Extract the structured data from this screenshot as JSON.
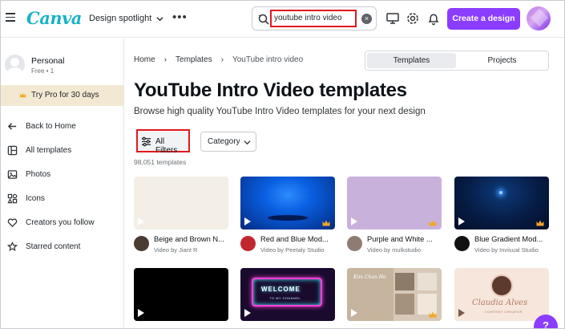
{
  "topbar": {
    "logo": "Canva",
    "spotlight_label": "Design spotlight",
    "more": "•••",
    "search_value": "youtube intro video",
    "create_label": "Create a design"
  },
  "sidebar": {
    "profile_name": "Personal",
    "profile_sub": "Free • 1",
    "try_pro": "Try Pro for 30 days",
    "nav": [
      {
        "label": "Back to Home",
        "icon": "arrow-left-icon"
      },
      {
        "label": "All templates",
        "icon": "templates-icon"
      },
      {
        "label": "Photos",
        "icon": "photo-icon"
      },
      {
        "label": "Icons",
        "icon": "shapes-icon"
      },
      {
        "label": "Creators you follow",
        "icon": "heart-icon"
      },
      {
        "label": "Starred content",
        "icon": "star-icon"
      }
    ]
  },
  "main": {
    "breadcrumb": [
      "Home",
      "Templates",
      "YouTube intro video"
    ],
    "tabs": [
      "Templates",
      "Projects"
    ],
    "title": "YouTube Intro Video templates",
    "subtitle": "Browse high quality YouTube Intro Video templates for your next design",
    "filters_label": "All Filters",
    "category_label": "Category",
    "count": "98,051 templates"
  },
  "cards": [
    {
      "title": "Beige and Brown N...",
      "by": "Video by Jiant R"
    },
    {
      "title": "Red and Blue Mod...",
      "by": "Video by Peetaly Studio"
    },
    {
      "title": "Purple and White ...",
      "by": "Video by mulkstudio"
    },
    {
      "title": "Blue Gradient Mod...",
      "by": "Video by Invisual Studio"
    }
  ],
  "thumb_text": {
    "neon_title": "WELCOME",
    "neon_sub": "TO MY CHANNEL",
    "script_name": "Kim Chan Ho",
    "claudia_name": "Claudia Alves",
    "claudia_role": "CONTENT CREATOR"
  },
  "help_label": "?",
  "colors": {
    "brand_purple": "#8b3dff",
    "logo_teal": "#18b2c8",
    "highlight_red": "#e0191e",
    "pro_banner": "#f3e9d2"
  }
}
